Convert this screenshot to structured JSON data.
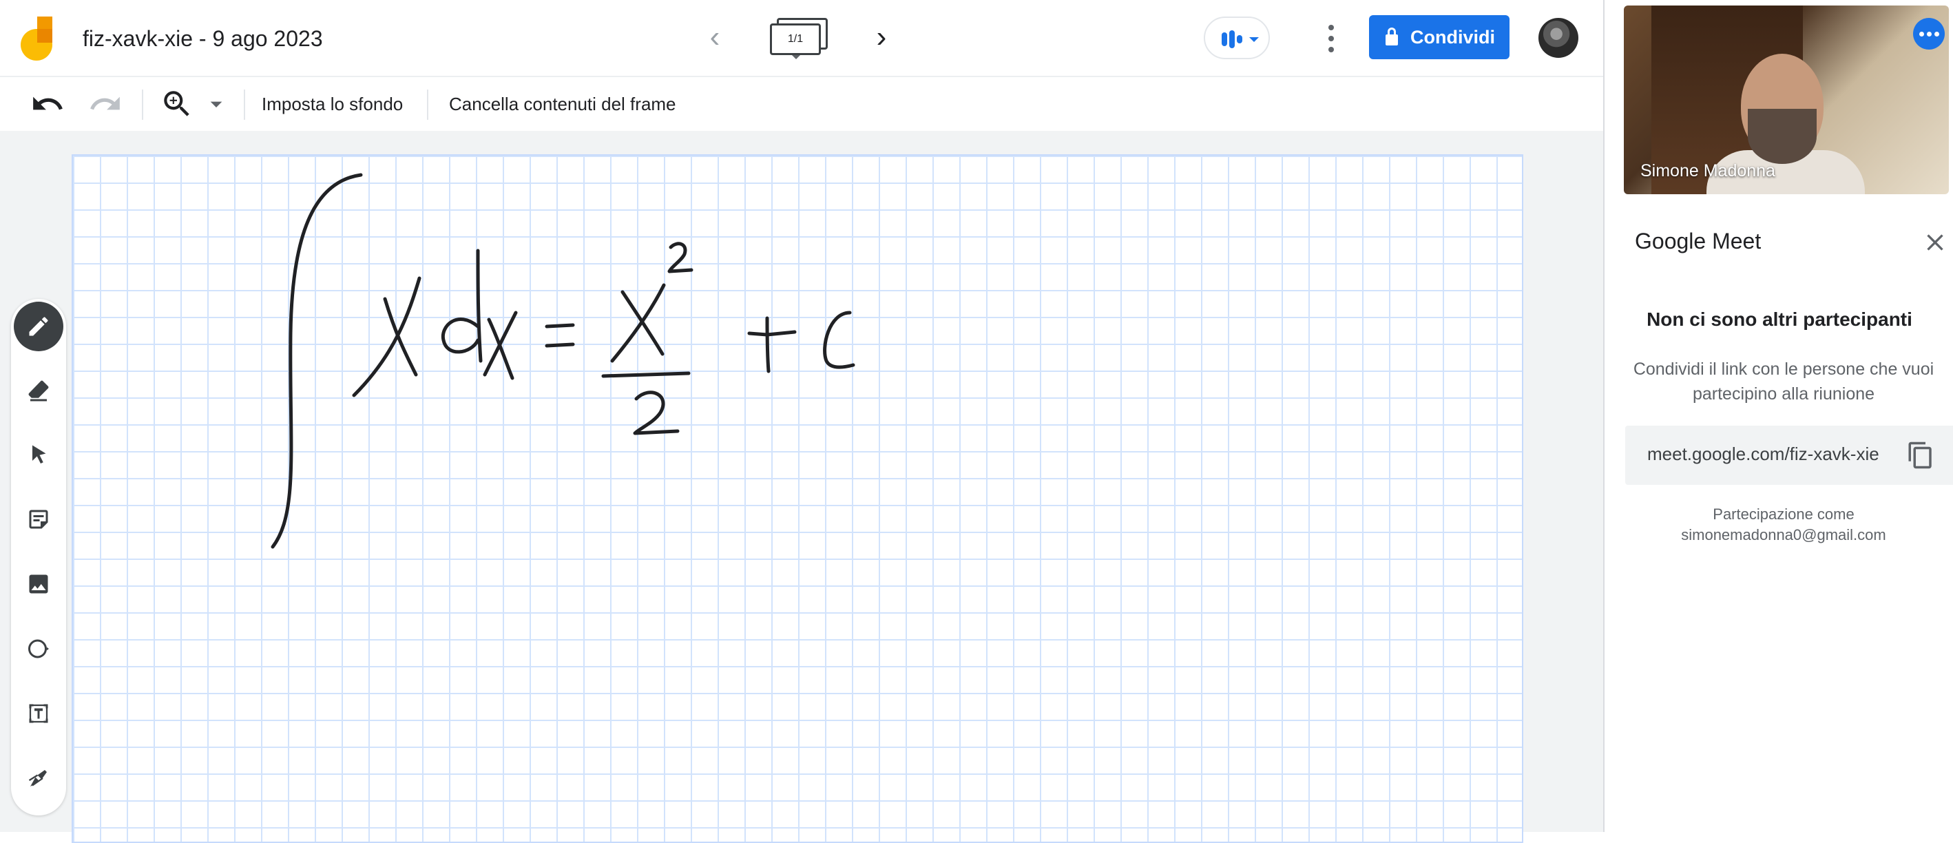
{
  "app": {
    "title": "fiz-xavk-xie - 9 ago 2023",
    "frame_indicator": "1/1",
    "share_label": "Condividi"
  },
  "toolbar": {
    "set_background": "Imposta lo sfondo",
    "clear_frame": "Cancella contenuti del frame"
  },
  "tools": [
    "pen",
    "eraser",
    "select",
    "sticky-note",
    "image",
    "shape",
    "text-box",
    "laser"
  ],
  "board": {
    "handwriting": "∫ x dx = x² / 2 + c"
  },
  "meet": {
    "participant_name": "Simone Madonna",
    "panel_title": "Google Meet",
    "heading": "Non ci sono altri partecipanti",
    "description": "Condividi il link con le persone che vuoi partecipino alla riunione",
    "link": "meet.google.com/fiz-xavk-xie",
    "joined_as_label": "Partecipazione come",
    "joined_as_email": "simonemadonna0@gmail.com"
  },
  "colors": {
    "accent": "#1a73e8",
    "grid": "#d2e3fc",
    "ink": "#202124"
  }
}
